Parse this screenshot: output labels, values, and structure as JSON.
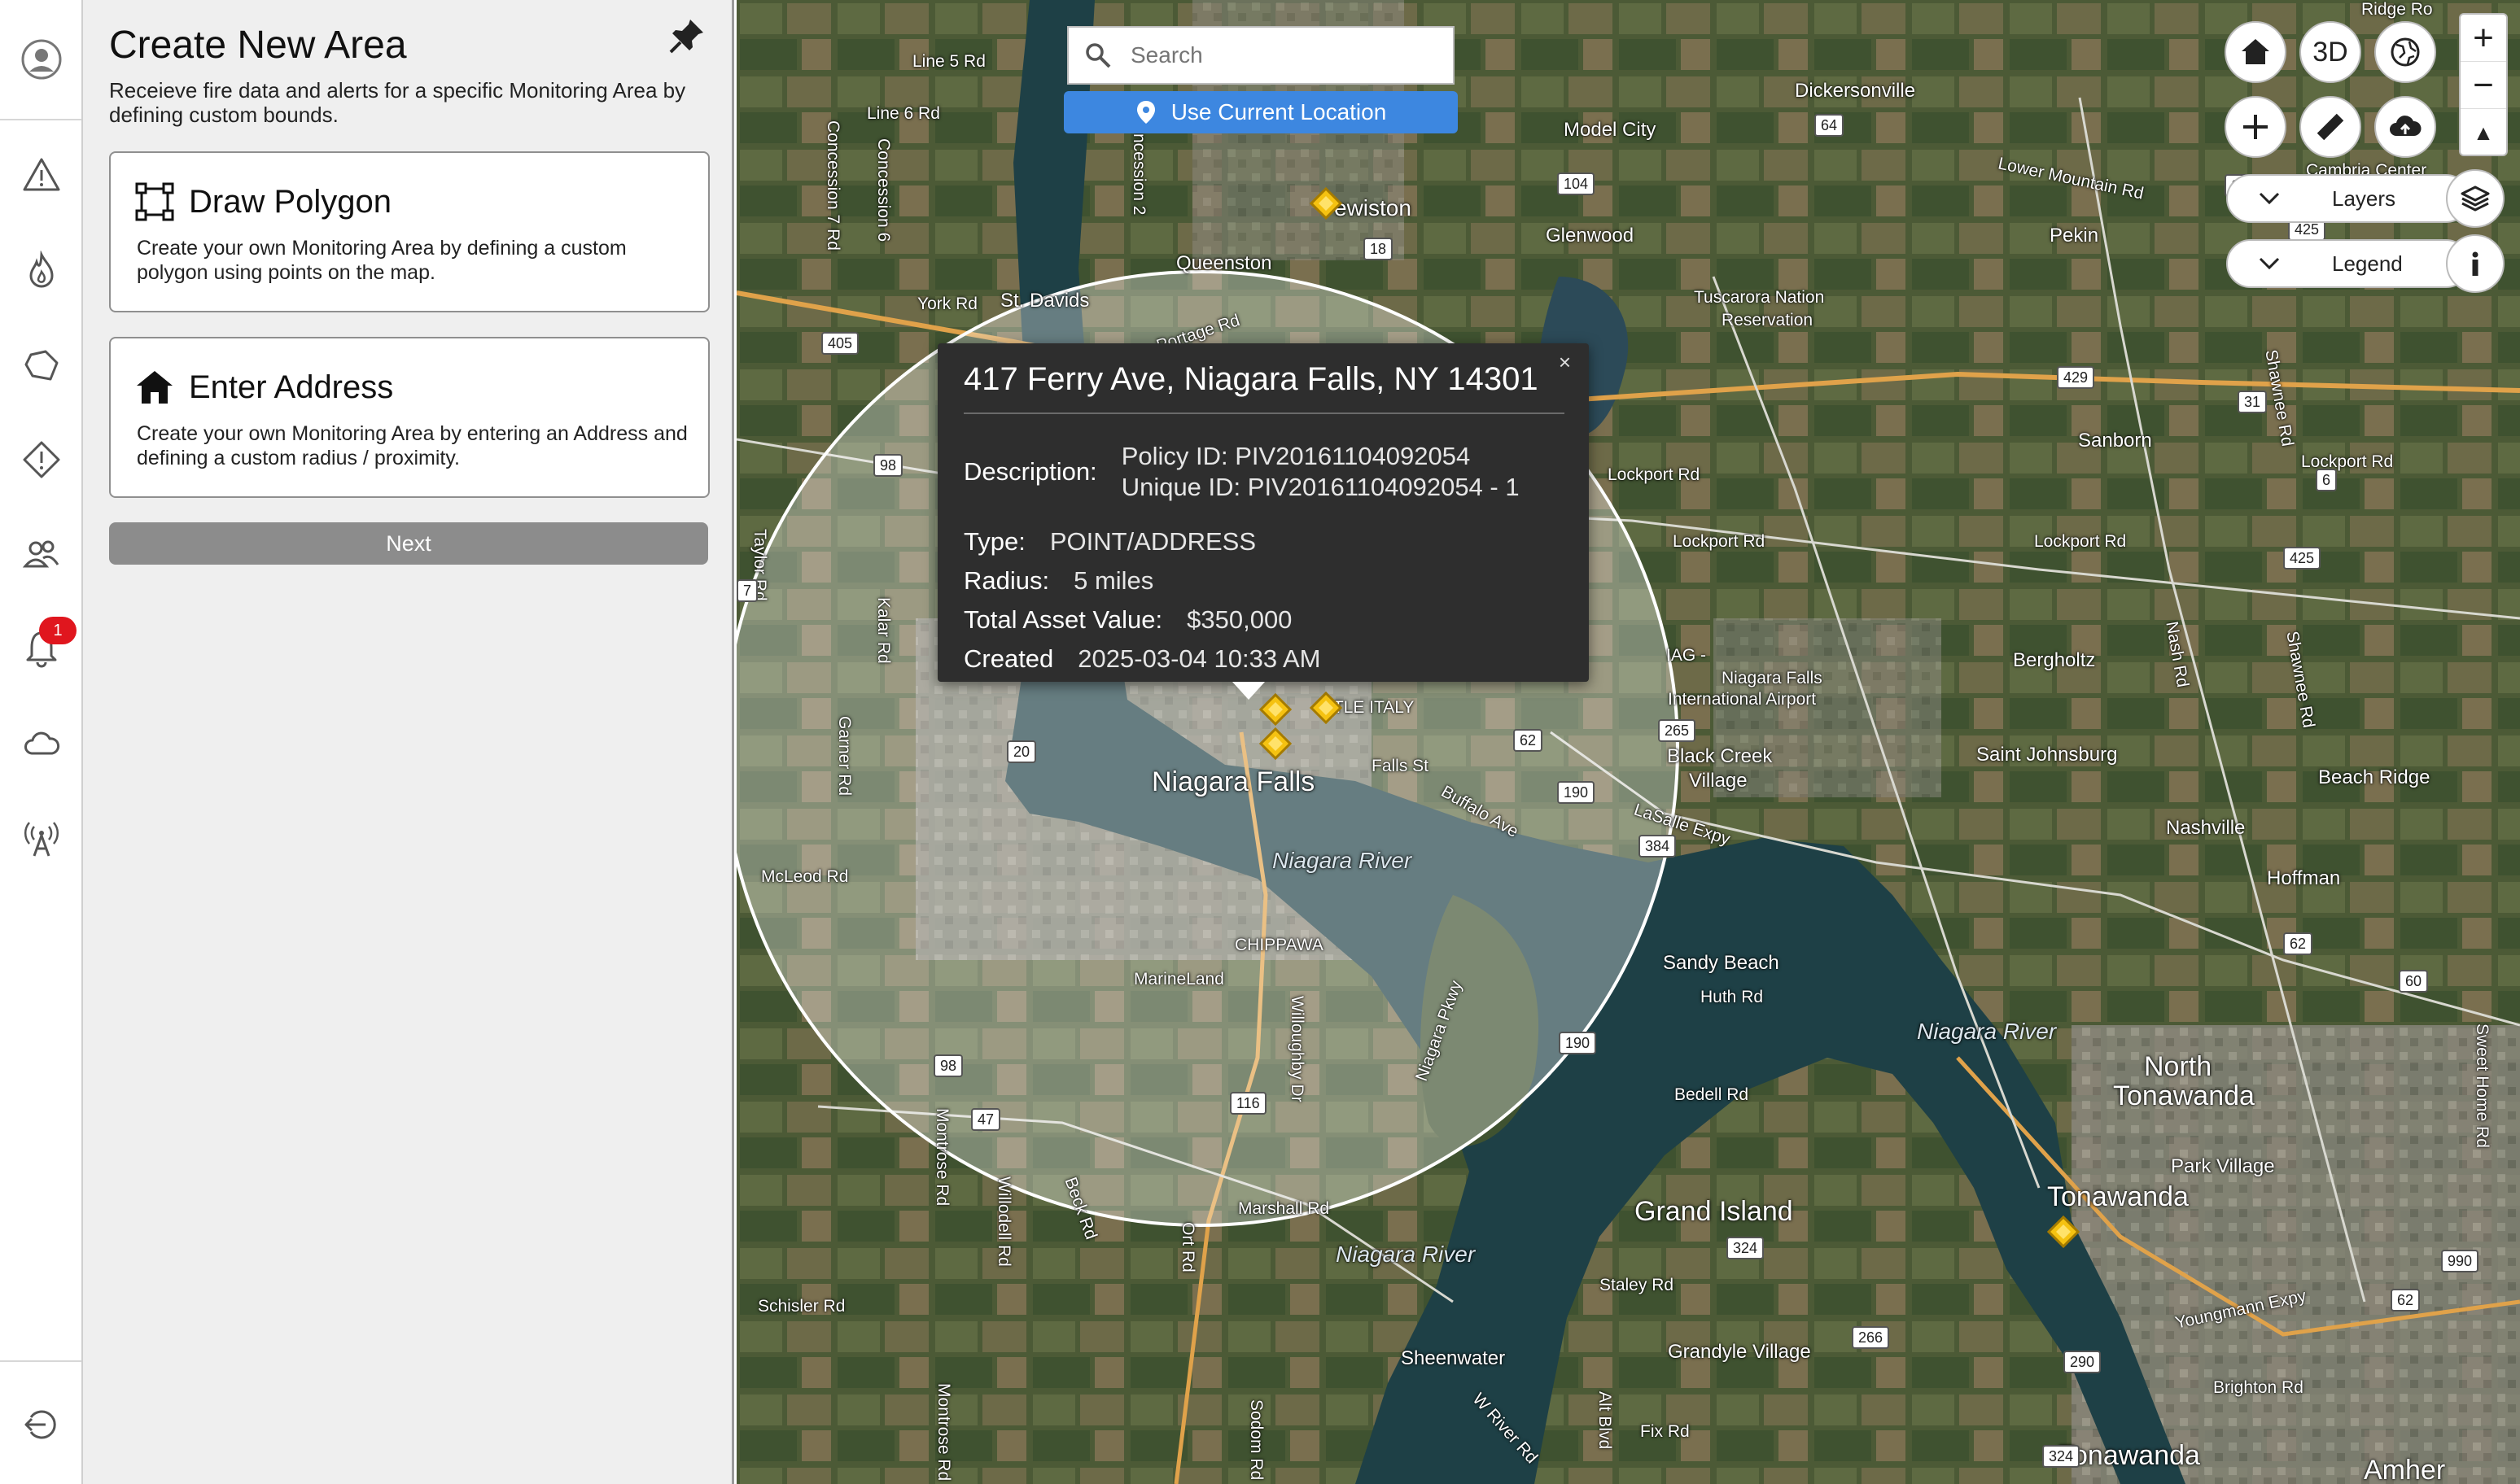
{
  "rail": {
    "items": [
      "profile",
      "alerts",
      "fires",
      "areas",
      "incidents",
      "users",
      "notifications",
      "weather",
      "tower",
      "logout"
    ],
    "notification_count": "1"
  },
  "panel": {
    "title": "Create New Area",
    "subtitle": "Receieve fire data and alerts for a specific Monitoring Area by defining custom bounds.",
    "options": [
      {
        "title": "Draw Polygon",
        "description": "Create your own Monitoring Area by defining a custom polygon using points on the map.",
        "icon": "polygon-icon"
      },
      {
        "title": "Enter Address",
        "description": "Create your own Monitoring Area by entering an Address and defining a custom radius / proximity.",
        "icon": "house-icon"
      }
    ],
    "next_label": "Next"
  },
  "map": {
    "search_placeholder": "Search",
    "use_location_label": "Use Current Location",
    "controls": {
      "three_d_label": "3D",
      "zoom_in": "+",
      "zoom_out": "−",
      "layers_label": "Layers",
      "legend_label": "Legend"
    },
    "popup": {
      "title": "417 Ferry Ave, Niagara Falls, NY 14301",
      "close": "×",
      "description_key": "Description:",
      "description_lines": [
        "Policy ID: PIV20161104092054",
        "Unique ID: PIV20161104092054 - 1"
      ],
      "type_key": "Type:",
      "type_val": "POINT/ADDRESS",
      "radius_key": "Radius:",
      "radius_val": "5 miles",
      "asset_key": "Total Asset Value:",
      "asset_val": "$350,000",
      "created_key": "Created",
      "created_val": "2025-03-04 10:33 AM"
    },
    "labels": {
      "niagara_falls": "Niagara Falls",
      "niagara_river_1": "Niagara River",
      "niagara_river_2": "Niagara River",
      "niagara_river_3": "Niagara River",
      "north_tonawanda_1": "North",
      "north_tonawanda_2": "Tonawanda",
      "tonawanda": "Tonawanda",
      "tonawanda_s": "Tonawanda",
      "grand_island": "Grand Island",
      "lewiston": "ewiston",
      "queenston": "Queenston",
      "st_davids": "St. Davids",
      "model_city": "Model City",
      "dickersonville": "Dickersonville",
      "glenwood": "Glenwood",
      "pekin": "Pekin",
      "sanborn": "Sanborn",
      "tuscarora_1": "Tuscarora Nation",
      "tuscarora_2": "Reservation",
      "bergholtz": "Bergholtz",
      "saint_johnsburg": "Saint Johnsburg",
      "black_creek_1": "Black Creek",
      "black_creek_2": "Village",
      "beach_ridge": "Beach Ridge",
      "nashville": "Nashville",
      "hoffman": "Hoffman",
      "sandy_beach": "Sandy Beach",
      "park_village": "Park Village",
      "grandyle": "Grandyle Village",
      "sheenwater": "Sheenwater",
      "marineland": "MarineLand",
      "chippawa": "CHIPPAWA",
      "little_italy": "TTLE ITALY",
      "iag_1": "IAG -",
      "iag_2": "Niagara Falls",
      "iag_3": "International Airport",
      "brighton": "Brighton Rd",
      "cambria": "Cambria Center",
      "amherst": "Amher",
      "line5": "Line 5 Rd",
      "line6": "Line 6 Rd",
      "york": "York Rd",
      "taylor": "Taylor Rd",
      "kalar": "Kalar Rd",
      "garner": "Garner Rd",
      "mcleod": "McLeod Rd",
      "schisler": "Schisler Rd",
      "montrose": "Montrose Rd",
      "montrose2": "Montrose Rd",
      "willodell": "Willodell Rd",
      "beck": "Beck Rd",
      "ort": "Ort Rd",
      "sodom": "Sodom Rd",
      "marshall": "Marshall Rd",
      "willoughby": "Willoughby Dr",
      "niagara_pkwy": "Niagara Pkwy",
      "falls_st": "Falls St",
      "buffalo": "Buffalo Ave",
      "lasalle": "LaSalle Expy",
      "huth": "Huth Rd",
      "bedell": "Bedell Rd",
      "staley": "Staley Rd",
      "fix": "Fix Rd",
      "wriver": "W River Rd",
      "alt_blvd": "Alt Blvd",
      "lockport1": "Lockport Rd",
      "lockport2": "Lockport Rd",
      "lockport3": "Lockport Rd",
      "lower_mtn": "Lower Mountain Rd",
      "portage": "Portage Rd",
      "concession6": "Concession 6",
      "concession2": "ncession 2",
      "concession_rd": "Concession 7 Rd",
      "nash": "Nash Rd",
      "shawnee1": "Shawnee Rd",
      "shawnee2": "Shawnee Rd",
      "sweet_home": "Sweet Home Rd",
      "youngmann": "Youngmann Expy",
      "ridge": "Ridge Ro"
    },
    "shields": [
      "405",
      "98",
      "20",
      "62",
      "190",
      "384",
      "265",
      "98",
      "116",
      "47",
      "190",
      "18",
      "104",
      "64",
      "429",
      "31",
      "6",
      "425",
      "64",
      "425",
      "62",
      "60",
      "324",
      "266",
      "290",
      "62",
      "990",
      "324",
      "7"
    ]
  }
}
